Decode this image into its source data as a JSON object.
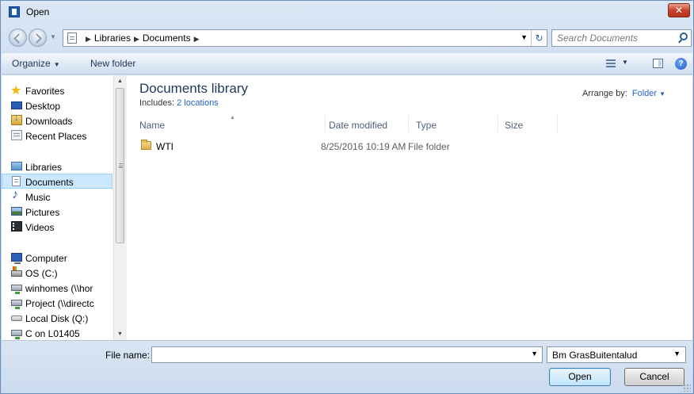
{
  "window": {
    "title": "Open"
  },
  "address": {
    "crumbs": [
      "Libraries",
      "Documents"
    ]
  },
  "search": {
    "placeholder": "Search Documents"
  },
  "toolbar": {
    "organize": "Organize",
    "new_folder": "New folder"
  },
  "sidebar": {
    "favorites": {
      "label": "Favorites",
      "items": [
        "Desktop",
        "Downloads",
        "Recent Places"
      ]
    },
    "libraries": {
      "label": "Libraries",
      "items": [
        "Documents",
        "Music",
        "Pictures",
        "Videos"
      ],
      "selected": "Documents"
    },
    "computer": {
      "label": "Computer",
      "items": [
        "OS (C:)",
        "winhomes (\\\\hor",
        "Project (\\\\directc",
        "Local Disk (Q:)",
        "C on L01405"
      ]
    }
  },
  "library": {
    "title": "Documents library",
    "includes_label": "Includes:",
    "includes_link": "2 locations",
    "arrange_label": "Arrange by:",
    "arrange_value": "Folder"
  },
  "columns": [
    "Name",
    "Date modified",
    "Type",
    "Size"
  ],
  "files": [
    {
      "name": "WTI",
      "date": "8/25/2016 10:19 AM",
      "type": "File folder",
      "size": ""
    }
  ],
  "footer": {
    "file_name_label": "File name:",
    "file_name_value": "",
    "filter_value": "Bm GrasBuitentalud",
    "open_label": "Open",
    "cancel_label": "Cancel"
  },
  "icons": {
    "close": "close-icon",
    "back": "back-arrow-icon",
    "forward": "forward-arrow-icon",
    "refresh": "refresh-icon",
    "search": "search-icon",
    "help": "help-icon"
  },
  "colors": {
    "accent": "#1f63c7",
    "title_text": "#1e395b",
    "selection": "#cce8ff"
  }
}
